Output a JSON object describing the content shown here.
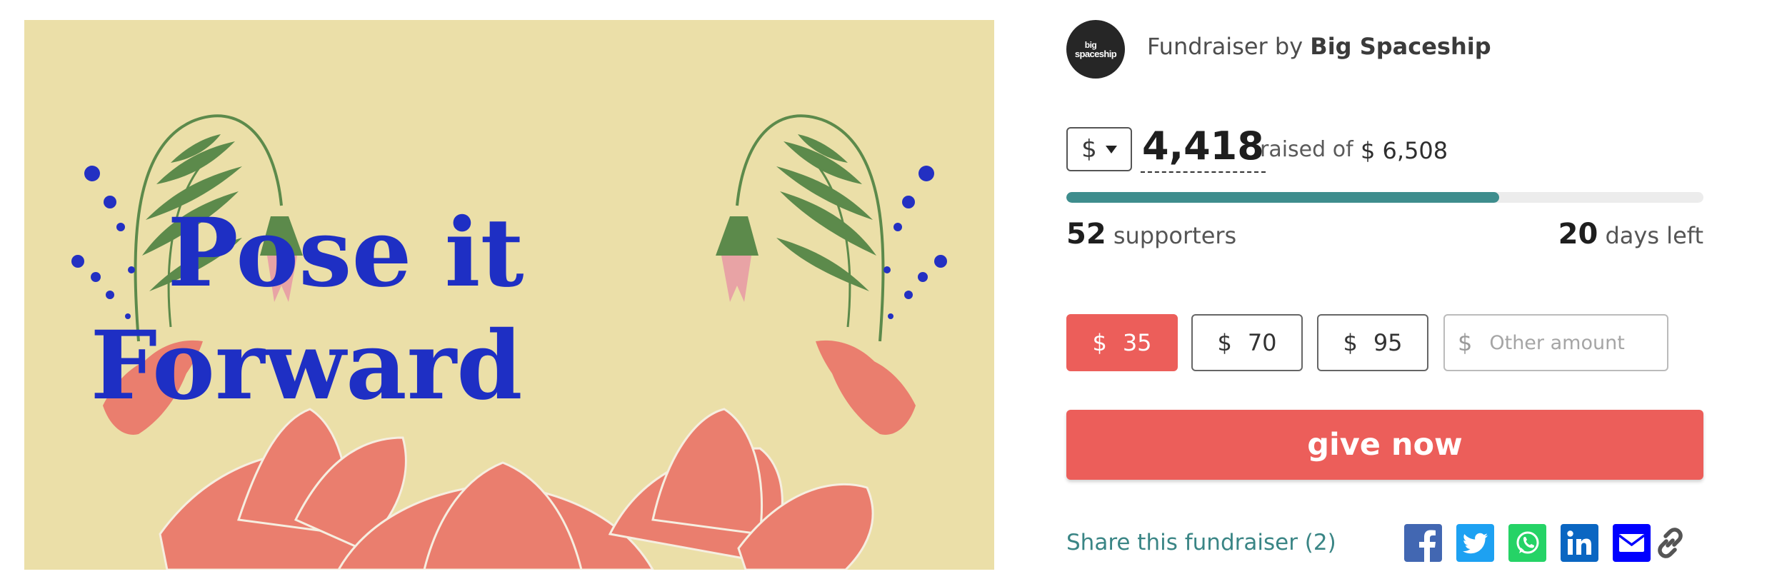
{
  "hero": {
    "title_line1": "Pose it",
    "title_line2": "Forward",
    "colors": {
      "background": "#ebdfa8",
      "title": "#1e2fc4",
      "lotus": "#ea7e6e",
      "leaf": "#5c8a4b",
      "dots": "#2330c2"
    }
  },
  "organiser": {
    "avatar_line1": "big",
    "avatar_line2": "spaceship",
    "prefix": "Fundraiser by",
    "name": "Big Spaceship"
  },
  "fundraiser": {
    "currency_symbol": "$",
    "raised": "4,418",
    "raised_of_label": "raised of",
    "goal": "$ 6,508",
    "progress_fraction": 0.679,
    "supporters_count": "52",
    "supporters_label": "supporters",
    "days_count": "20",
    "days_label": "days left"
  },
  "donation": {
    "amounts": [
      {
        "symbol": "$",
        "value": "35",
        "selected": true
      },
      {
        "symbol": "$",
        "value": "70",
        "selected": false
      },
      {
        "symbol": "$",
        "value": "95",
        "selected": false
      }
    ],
    "other_symbol": "$",
    "other_placeholder": "Other amount",
    "give_label": "give now"
  },
  "share": {
    "label": "Share this fundraiser (2)",
    "icons": [
      "facebook-icon",
      "twitter-icon",
      "whatsapp-icon",
      "linkedin-icon",
      "email-icon",
      "link-icon"
    ]
  },
  "colors": {
    "accent": "#ec5e5a",
    "teal": "#3e8d8d",
    "facebook": "#4267b2",
    "twitter": "#1da1f2",
    "whatsapp": "#25d366",
    "linkedin": "#0a66c2",
    "email": "#0000ff",
    "link": "#555555"
  }
}
